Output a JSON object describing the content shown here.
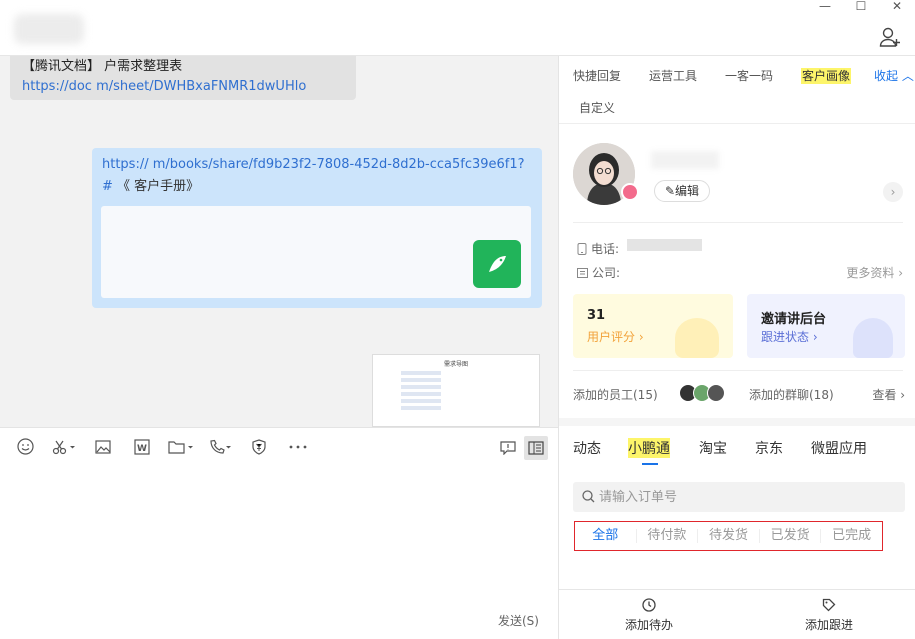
{
  "window": {
    "minimize": "—",
    "maximize": "☐",
    "close": "✕"
  },
  "chat": {
    "msg1_line1": "【腾讯文档】           户需求整理表",
    "msg1_line2": "https://doc           m/sheet/DWHBxaFNMR1dwUHlo",
    "msg2_link": "https://                     m/books/share/fd9b23f2-7808-452d-8d2b-cca5fc39e6f1?#",
    "msg2_tail": "《          客户手册》",
    "thumb_title": "需求导图"
  },
  "toolbar": {
    "send_label": "发送(S)"
  },
  "right": {
    "top_tabs": [
      "快捷回复",
      "运营工具",
      "一客一码",
      "客户画像"
    ],
    "collapse": "收起",
    "custom": "自定义",
    "edit": "编辑",
    "phone_label": "电话:",
    "company_label": "公司:",
    "more_info": "更多资料",
    "score_value": "31",
    "score_label": "用户评分",
    "invite_title": "邀请讲后台",
    "follow_label": "跟进状态",
    "staff_label": "添加的员工(15)",
    "group_label": "添加的群聊(18)",
    "view": "查看",
    "sub_tabs": [
      "动态",
      "小鹏通",
      "淘宝",
      "京东",
      "微盟应用"
    ],
    "search_placeholder": "请输入订单号",
    "filters": [
      "全部",
      "待付款",
      "待发货",
      "已发货",
      "已完成"
    ],
    "add_todo": "添加待办",
    "add_followup": "添加跟进"
  },
  "colors": {
    "accent": "#1a73e8",
    "highlight": "#fdf56a",
    "border_red": "#e0262c",
    "bubble": "#cce4fb"
  }
}
